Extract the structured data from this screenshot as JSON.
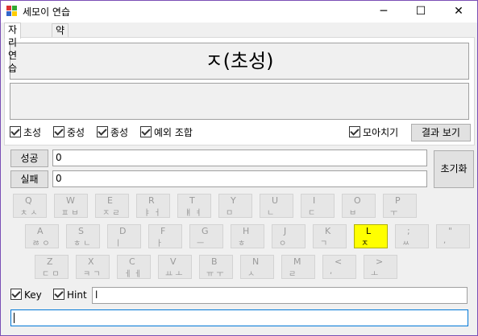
{
  "window": {
    "title": "세모이 연습"
  },
  "tabs": [
    {
      "label": "자리연습",
      "active": true
    },
    {
      "label": "약어연습",
      "active": false
    }
  ],
  "display": {
    "main": "ㅈ(초성)",
    "secondary": ""
  },
  "options": {
    "choseong": "초성",
    "jungseong": "중성",
    "jongseong": "종성",
    "exception": "예외 조합",
    "moachigi": "모아치기",
    "result_button": "결과 보기"
  },
  "stats": {
    "success_label": "성공",
    "success_value": "0",
    "fail_label": "실패",
    "fail_value": "0",
    "reset_button": "초기화"
  },
  "keyboard": {
    "row1": [
      {
        "en": "Q",
        "ko": "ㅊ ㅅ"
      },
      {
        "en": "W",
        "ko": "ㅍ ㅂ"
      },
      {
        "en": "E",
        "ko": "ㅈ ㄹ"
      },
      {
        "en": "R",
        "ko": "ㅑ ㅓ"
      },
      {
        "en": "T",
        "ko": "ㅒ ㅕ"
      },
      {
        "en": "Y",
        "ko": "ㅁ"
      },
      {
        "en": "U",
        "ko": "ㄴ"
      },
      {
        "en": "I",
        "ko": "ㄷ"
      },
      {
        "en": "O",
        "ko": "ㅂ"
      },
      {
        "en": "P",
        "ko": "ㅜ"
      }
    ],
    "row2": [
      {
        "en": "A",
        "ko": "ㅀ ㅇ"
      },
      {
        "en": "S",
        "ko": "ㅎ ㄴ"
      },
      {
        "en": "D",
        "ko": "ㅣ"
      },
      {
        "en": "F",
        "ko": "ㅏ"
      },
      {
        "en": "G",
        "ko": "ㅡ"
      },
      {
        "en": "H",
        "ko": "ㅎ"
      },
      {
        "en": "J",
        "ko": "ㅇ"
      },
      {
        "en": "K",
        "ko": "ㄱ"
      },
      {
        "en": "L",
        "ko": "ㅈ",
        "highlight": true
      },
      {
        "en": ";",
        "ko": "ㅆ"
      },
      {
        "en": "\"",
        "ko": ","
      }
    ],
    "row3": [
      {
        "en": "Z",
        "ko": "ㄷ ㅁ"
      },
      {
        "en": "X",
        "ko": "ㅋ ㄱ"
      },
      {
        "en": "C",
        "ko": "ㅔ ㅔ"
      },
      {
        "en": "V",
        "ko": "ㅛ ㅗ"
      },
      {
        "en": "B",
        "ko": "ㅠ ㅜ"
      },
      {
        "en": "N",
        "ko": "ㅅ"
      },
      {
        "en": "M",
        "ko": "ㄹ"
      },
      {
        "en": "<",
        "ko": ","
      },
      {
        "en": ">",
        "ko": "ㅗ"
      }
    ]
  },
  "bottom": {
    "key_label": "Key",
    "hint_label": "Hint",
    "hint_value": "l",
    "input_value": ""
  }
}
